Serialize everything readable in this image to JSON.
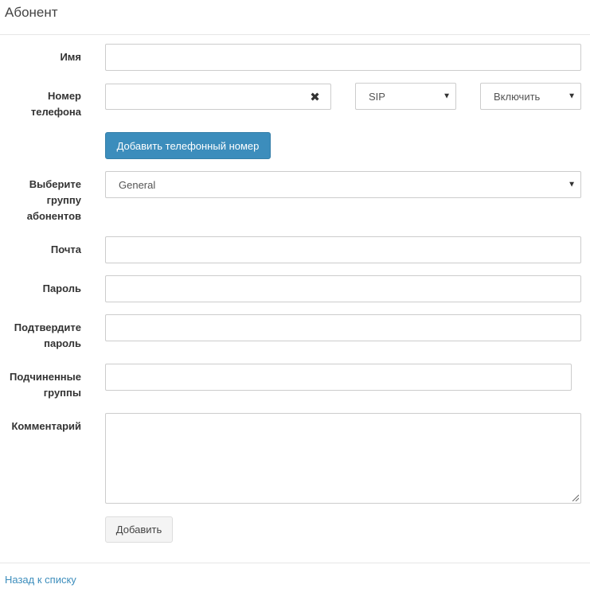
{
  "header": {
    "title": "Абонент"
  },
  "form": {
    "name_label": "Имя",
    "phone_label": "Номер телефона",
    "phone_clear_icon": "close-icon",
    "phone_type_value": "SIP",
    "phone_state_value": "Включить",
    "add_phone_label": "Добавить телефонный номер",
    "group_label": "Выберите группу абонентов",
    "group_value": "General",
    "email_label": "Почта",
    "password_label": "Пароль",
    "confirm_password_label": "Подтвердите пароль",
    "subgroups_label": "Подчиненные группы",
    "comment_label": "Комментарий",
    "submit_label": "Добавить"
  },
  "footer": {
    "back_link": "Назад к списку"
  },
  "colors": {
    "primary": "#3c8dbc",
    "link": "#3c8dbc",
    "border": "#cccccc"
  }
}
